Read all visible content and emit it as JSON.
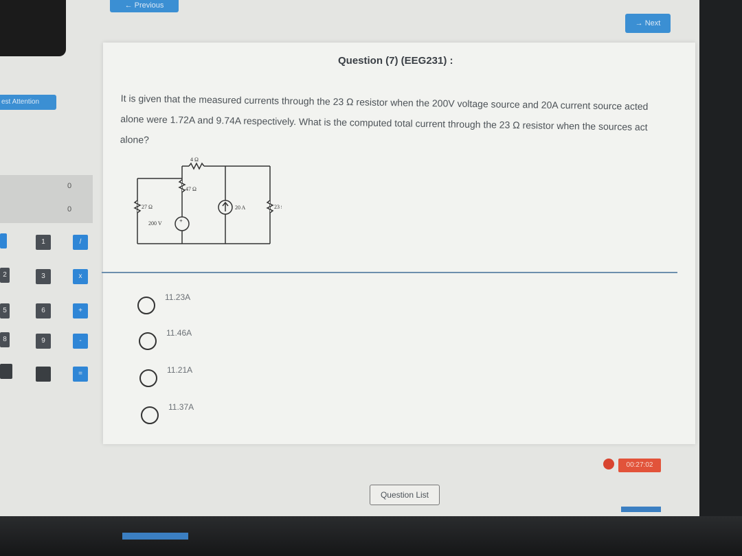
{
  "nav": {
    "previous_label": "← Previous",
    "next_label": "→ Next"
  },
  "sidebar": {
    "attention_label": "est Attention",
    "counts": [
      "0",
      "0"
    ],
    "keys": [
      {
        "label": "1",
        "style": "k-gray"
      },
      {
        "label": "/",
        "style": "k-blue"
      },
      {
        "label": "3",
        "style": "k-gray"
      },
      {
        "label": "x",
        "style": "k-blue"
      },
      {
        "label": "6",
        "style": "k-gray"
      },
      {
        "label": "+",
        "style": "k-blue"
      },
      {
        "label": "9",
        "style": "k-gray"
      },
      {
        "label": "-",
        "style": "k-blue"
      },
      {
        "label": "",
        "style": "k-dark"
      },
      {
        "label": "=",
        "style": "k-blue"
      }
    ],
    "left_keys": [
      "2",
      "5",
      "8"
    ]
  },
  "question": {
    "title": "Question (7) (EEG231) :",
    "text": "It is given that the measured currents through the 23 Ω resistor when the 200V voltage source and 20A current source acted alone were 1.72A and 9.74A respectively. What is the computed total current through the 23 Ω resistor when the sources act alone?",
    "circuit": {
      "r_top": "4 Ω",
      "r_mid": "47 Ω",
      "r_left": "27 Ω",
      "v_source": "200 V",
      "i_source": "20 A",
      "r_right": "23 Ω"
    },
    "options": [
      "11.23A",
      "11.46A",
      "11.21A",
      "11.37A"
    ]
  },
  "timer": {
    "value": "00:27:02"
  },
  "footer": {
    "question_list_label": "Question List"
  }
}
